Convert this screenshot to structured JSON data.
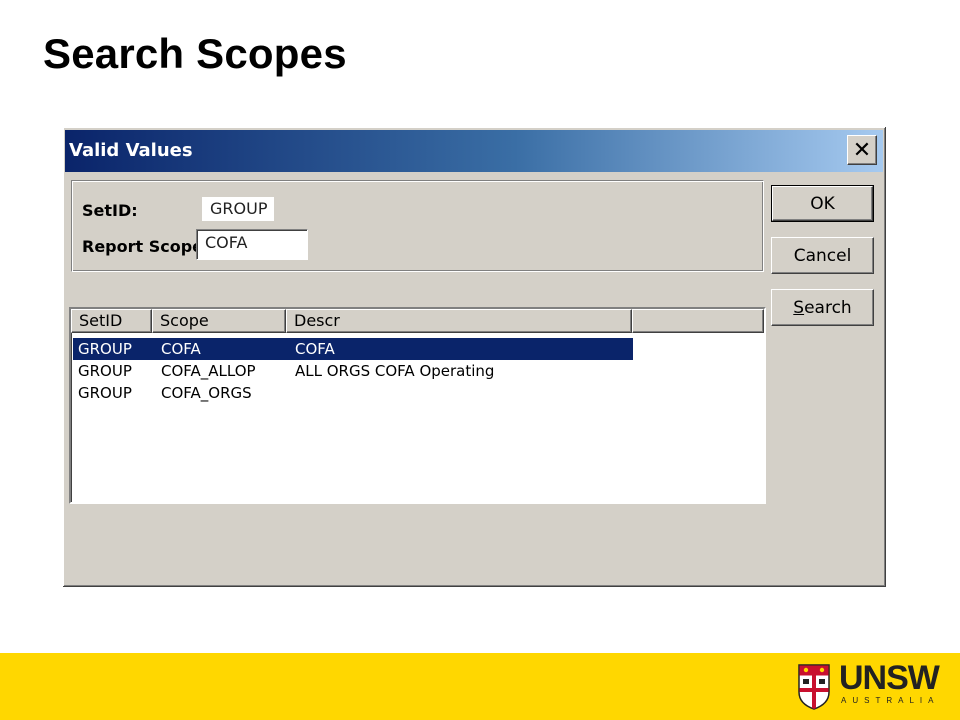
{
  "slide": {
    "title": "Search Scopes"
  },
  "dialog": {
    "title": "Valid Values",
    "close_icon": "close-icon",
    "criteria": {
      "setid_label": "SetID:",
      "setid_value": "GROUP",
      "report_scope_label": "Report Scope:",
      "report_scope_value": "COFA"
    },
    "buttons": {
      "ok": "OK",
      "cancel": "Cancel",
      "search": "Search"
    },
    "list": {
      "columns": [
        "SetID",
        "Scope",
        "Descr",
        ""
      ],
      "rows": [
        {
          "setid": "GROUP",
          "scope": "COFA",
          "descr": "COFA",
          "selected": true
        },
        {
          "setid": "GROUP",
          "scope": "COFA_ALLOP",
          "descr": "ALL ORGS COFA Operating",
          "selected": false
        },
        {
          "setid": "GROUP",
          "scope": "COFA_ORGS",
          "descr": "",
          "selected": false
        }
      ]
    }
  },
  "footer": {
    "logo_text": "UNSW",
    "logo_subtext": "AUSTRALIA",
    "logo_icon": "unsw-crest-icon",
    "background_color": "#ffd700"
  },
  "colors": {
    "titlebar_start": "#0a246a",
    "titlebar_end": "#a6caf0",
    "selection": "#0a246a",
    "dialog_face": "#d4d0c8"
  }
}
